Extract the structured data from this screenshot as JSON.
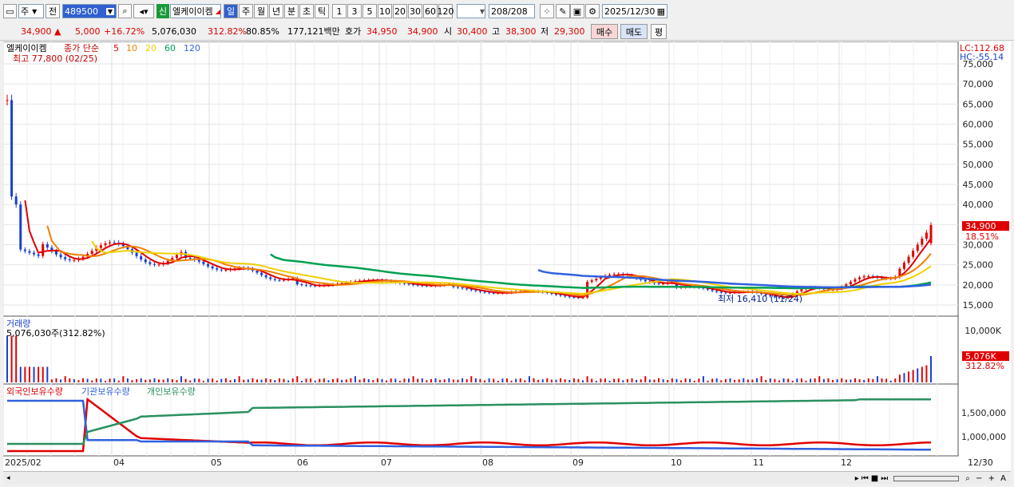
{
  "toolbar": {
    "stock_type": "주",
    "jeon": "전",
    "code": "489500",
    "credit_badge": "신",
    "stock_name": "엘케이이켐",
    "periods": [
      "일",
      "주",
      "월",
      "년",
      "분",
      "초",
      "틱"
    ],
    "active_period": "일",
    "minute_steps": [
      "1",
      "3",
      "5",
      "10",
      "20",
      "30",
      "60",
      "120"
    ],
    "count": "208",
    "count_total": "/208",
    "date": "2025/12/30"
  },
  "quote": {
    "price": "34,900",
    "arrow": "▲",
    "change": "5,000",
    "change_pct": "+16.72%",
    "volume": "5,076,030",
    "volume_ratio": "312.82%",
    "turnover": "80.85%",
    "amount": "177,121백만",
    "ask_label": "호가",
    "ask1": "34,950",
    "ask2": "34,900",
    "open_label": "시",
    "open": "30,400",
    "high_label": "고",
    "high": "38,300",
    "low_label": "저",
    "low": "29,300",
    "buy_label": "매수",
    "sell_label": "매도",
    "eval_label": "평"
  },
  "price_panel": {
    "name": "엘케이이켐",
    "ma_label": "종가 단순",
    "ma_periods": [
      "5",
      "10",
      "20",
      "60",
      "120"
    ],
    "ma_colors": [
      "#e00000",
      "#f08000",
      "#f0d000",
      "#00a050",
      "#3060e0"
    ],
    "high_note": "최고 77,800 (02/25)",
    "low_note": "최저 16,410 (11/24)",
    "lc": "LC:112.68",
    "hc": "HC:-55.14",
    "y_ticks": [
      "75,000",
      "70,000",
      "65,000",
      "60,000",
      "55,000",
      "50,000",
      "45,000",
      "40,000",
      "35,000",
      "30,000",
      "25,000",
      "20,000",
      "15,000"
    ],
    "last_price_tag": "34,900",
    "last_pct_tag": "18.51%"
  },
  "volume_panel": {
    "title": "거래량",
    "value_note": "5,076,030주(312.82%)",
    "y_tick": "10,000K",
    "tag": "5,076K",
    "tag_pct": "312.82%"
  },
  "holdings_panel": {
    "series": [
      "외국인보유수량",
      "기관보유수량",
      "개인보유수량"
    ],
    "colors": [
      "#e00000",
      "#3060e0",
      "#2a9060"
    ],
    "y_ticks": [
      "1,500,000",
      "1,000,000"
    ]
  },
  "x_axis": {
    "labels": [
      "2025/02",
      "04",
      "05",
      "06",
      "07",
      "08",
      "09",
      "10",
      "11",
      "12"
    ],
    "right_label": "12/30"
  }
}
